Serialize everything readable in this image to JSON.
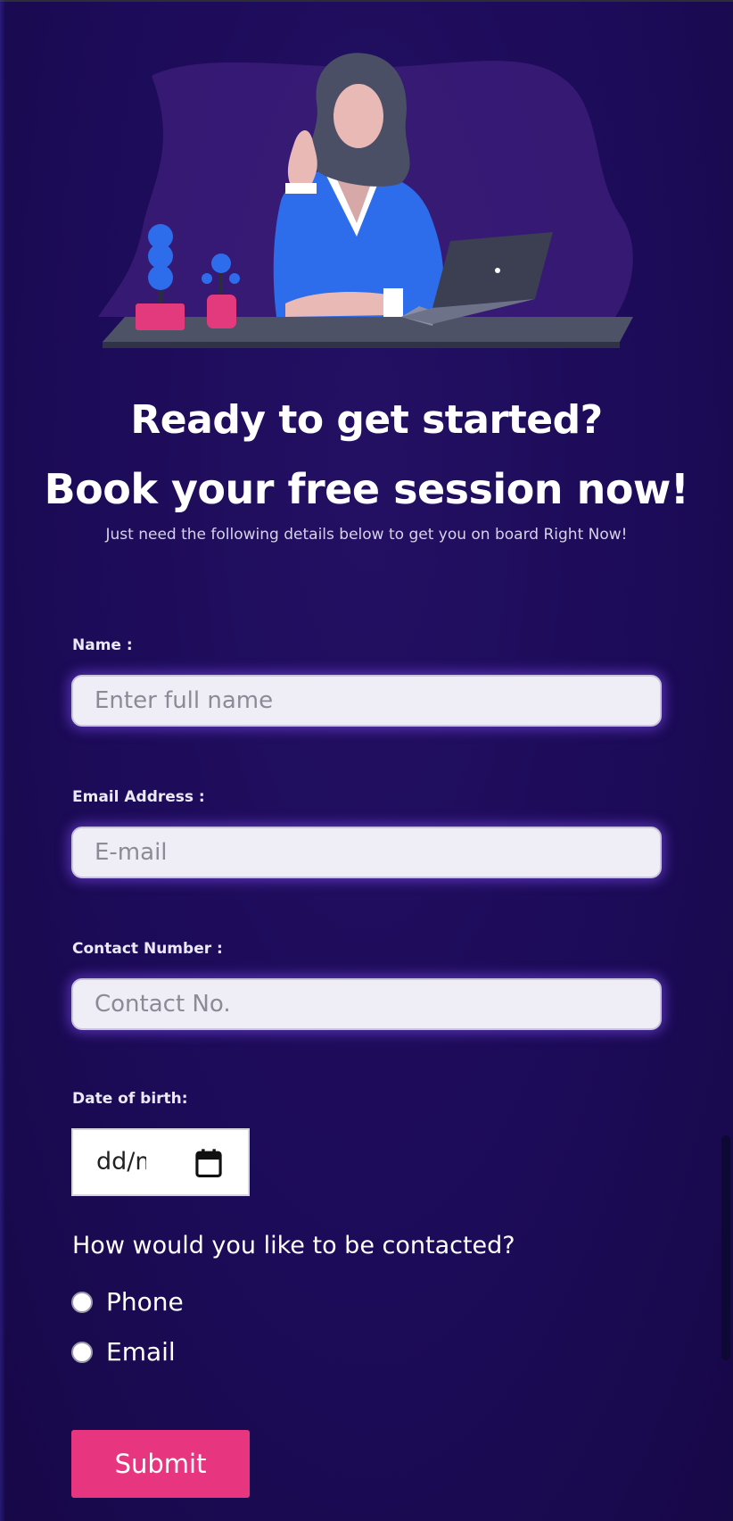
{
  "headline": {
    "line1": "Ready to get started?",
    "line2": "Book your free session now!",
    "subtitle": "Just need the following details below to get you on board Right Now!"
  },
  "form": {
    "name": {
      "label": "Name :",
      "placeholder": "Enter full name",
      "value": ""
    },
    "email": {
      "label": "Email Address :",
      "placeholder": "E-mail",
      "value": ""
    },
    "contact": {
      "label": "Contact Number :",
      "placeholder": "Contact No.",
      "value": ""
    },
    "dob": {
      "label": "Date of birth:",
      "display": "dd/mm/yyyy"
    },
    "contact_method": {
      "question": "How would you like to be contacted?",
      "options": [
        {
          "label": "Phone",
          "selected": false
        },
        {
          "label": "Email",
          "selected": false
        }
      ]
    },
    "submit_label": "Submit"
  },
  "icons": {
    "date_picker": "calendar-icon",
    "hero": "woman-at-desk-illustration"
  },
  "colors": {
    "background": "#1c0b58",
    "accent": "#e8357f",
    "input_glow": "#8954ff",
    "input_bg": "#efedf5"
  }
}
